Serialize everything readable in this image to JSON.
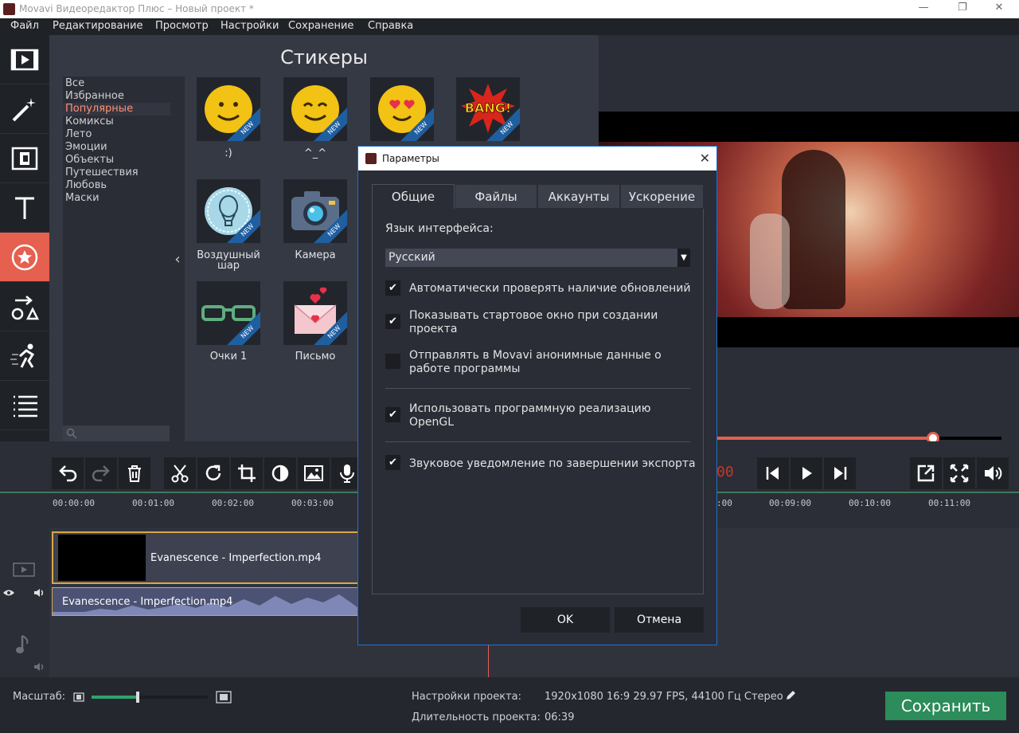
{
  "window": {
    "title": "Movavi Видеоредактор Плюс – Новый проект *",
    "controls": [
      "—",
      "❐",
      "✕"
    ]
  },
  "menu": [
    "Файл",
    "Редактирование",
    "Просмотр",
    "Настройки",
    "Сохранение",
    "Справка"
  ],
  "left_tools": [
    "video-import-icon",
    "magic-wand-icon",
    "clip-filter-icon",
    "text-icon",
    "sticker-icon",
    "shapes-icon",
    "motion-icon",
    "list-icon"
  ],
  "stickers_panel": {
    "title": "Стикеры",
    "categories": [
      "Все",
      "Избранное",
      "Популярные",
      "Комиксы",
      "Лето",
      "Эмоции",
      "Объекты",
      "Путешествия",
      "Любовь",
      "Маски"
    ],
    "active_category": "Популярные",
    "collapse_glyph": "‹",
    "items": [
      {
        "label": ":)",
        "badge": "NEW"
      },
      {
        "label": "^_^",
        "badge": "NEW"
      },
      {
        "label": "",
        "badge": "NEW"
      },
      {
        "label": "",
        "badge": "NEW"
      },
      {
        "label": "Воздушный шар",
        "badge": "NEW"
      },
      {
        "label": "Камера",
        "badge": "NEW"
      },
      {
        "label": "Очки 1",
        "badge": "NEW"
      },
      {
        "label": "Письмо",
        "badge": "NEW"
      }
    ],
    "bang_text": "BANG!"
  },
  "player": {
    "seek_fraction": 0.76,
    "time_fragment": "00"
  },
  "timeline": {
    "ruler_ticks": [
      "00:00:00",
      "00:01:00",
      "00:02:00",
      "00:03:00",
      ":00",
      "00:09:00",
      "00:10:00",
      "00:11:00"
    ],
    "video_clip": "Evanescence - Imperfection.mp4",
    "audio_clip": "Evanescence - Imperfection.mp4"
  },
  "bottom": {
    "zoom_label": "Масштаб:",
    "zoom_fraction": 0.4,
    "project_settings_label": "Настройки проекта:",
    "project_settings_value": "1920x1080 16:9 29.97 FPS, 44100 Гц Стерео",
    "duration_label": "Длительность проекта:",
    "duration_value": "06:39",
    "save_button": "Сохранить"
  },
  "dialog": {
    "title": "Параметры",
    "close": "✕",
    "tabs": [
      "Общие",
      "Файлы",
      "Аккаунты",
      "Ускорение"
    ],
    "active_tab": "Общие",
    "language_label": "Язык интерфейса:",
    "language_value": "Русский",
    "options": [
      {
        "label": "Автоматически проверять наличие обновлений",
        "checked": true
      },
      {
        "label": "Показывать стартовое окно при создании проекта",
        "checked": true
      },
      {
        "label": "Отправлять в Movavi анонимные данные о работе программы",
        "checked": false
      },
      {
        "label": "Использовать программную реализацию OpenGL",
        "checked": true
      },
      {
        "label": "Звуковое уведомление по завершении экспорта",
        "checked": true
      }
    ],
    "ok_label": "OK",
    "cancel_label": "Отмена"
  },
  "colors": {
    "accent_red": "#e5604f",
    "save_green": "#2c8c5a",
    "dialog_border": "#1f6fd0"
  }
}
